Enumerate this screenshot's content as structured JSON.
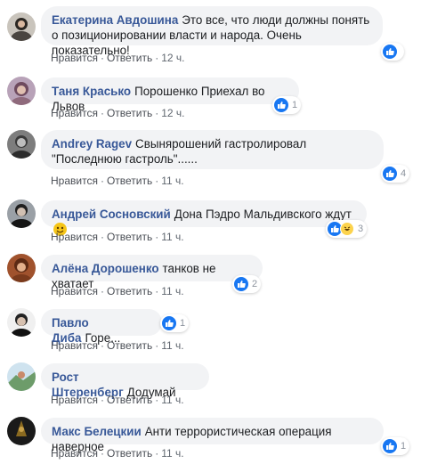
{
  "action_like": "Нравится",
  "action_reply": "Ответить",
  "action_dot": "·",
  "comments": [
    {
      "author": "Екатерина Авдошина",
      "text": "Это все, что люди должны понять о позиционировании власти и народа. Очень показательно!",
      "time": "12 ч.",
      "reactions": "",
      "avatar_icon": "user-avatar-icon"
    },
    {
      "author": "Таня Красько",
      "text": "Порошенко Приехал во Львов",
      "time": "12 ч.",
      "reactions": "1",
      "avatar_icon": "user-avatar-icon"
    },
    {
      "author": "Andrey Ragev",
      "text": "Свынярошений гастролировал \"Последнюю гастроль\"......",
      "time": "11 ч.",
      "reactions": "4",
      "avatar_icon": "user-avatar-icon"
    },
    {
      "author": "Андрей Сосновский",
      "text": "Дона Пэдро Мальдивского ждут",
      "time": "11 ч.",
      "reactions": "3",
      "avatar_icon": "user-avatar-icon"
    },
    {
      "author": "Алёна Дорошенко",
      "text": "танков не хватает",
      "time": "11 ч.",
      "reactions": "2",
      "avatar_icon": "user-avatar-icon"
    },
    {
      "author": "Павло Диба",
      "text": "Горе...",
      "time": "11 ч.",
      "reactions": "1",
      "avatar_icon": "user-avatar-icon"
    },
    {
      "author": "Рост Штеренберг",
      "text": "Додумай",
      "time": "11 ч.",
      "reactions": "",
      "avatar_icon": "user-avatar-icon"
    },
    {
      "author": "Макс Белецкии",
      "text": "Анти террористическая операция наверное",
      "time": "11 ч.",
      "reactions": "1",
      "avatar_icon": "user-avatar-icon"
    }
  ],
  "colors": {
    "author": "#385898",
    "bubble": "#f2f3f5",
    "like": "#1877f2",
    "meta": "#606770"
  }
}
